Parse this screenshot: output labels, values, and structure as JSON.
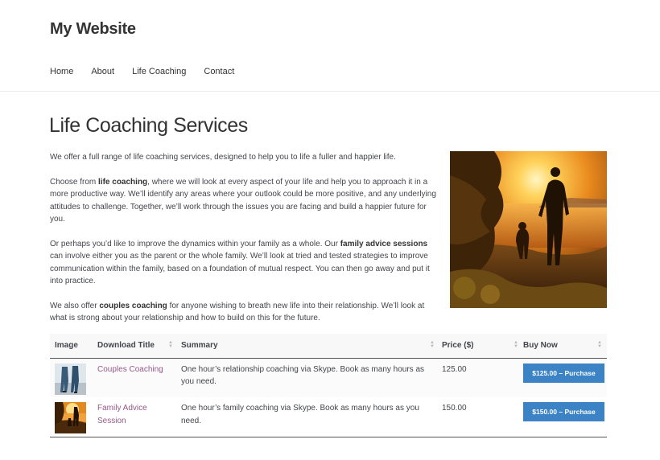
{
  "site": {
    "title": "My Website"
  },
  "nav": {
    "items": [
      "Home",
      "About",
      "Life Coaching",
      "Contact"
    ]
  },
  "page": {
    "title": "Life Coaching Services",
    "p1": "We offer a full range of life coaching services, designed to help you to life a fuller and happier life.",
    "p2_a": "Choose from ",
    "p2_b": "life coaching",
    "p2_c": ", where we will look at every aspect of your life and help you to approach it in a more productive way. We’ll identify any areas where your outlook could be more positive, and any underlying attitudes to challenge. Together, we’ll work through the issues you are facing and build a happier future for you.",
    "p3_a": "Or perhaps you’d like to improve the dynamics within your family as a whole. Our ",
    "p3_b": "family advice sessions",
    "p3_c": " can involve either you as the parent or the whole family. We’ll look at tried and tested strategies to improve communication within the family, based on a foundation of mutual respect. You can then go away and put it into practice.",
    "p4_a": "We also offer ",
    "p4_b": "couples coaching",
    "p4_c": " for anyone wishing to breath new life into their relationship. We’ll look at what is strong about your relationship and how to build on this for the future."
  },
  "table": {
    "headers": [
      "Image",
      "Download Title",
      "Summary",
      "Price ($)",
      "Buy Now"
    ],
    "rows": [
      {
        "title": "Couples Coaching",
        "summary": "One hour’s relationship coaching via Skype. Book as many hours as you need.",
        "price": "125.00",
        "button": "$125.00 – Purchase"
      },
      {
        "title": "Family Advice Session",
        "summary": "One hour’s family coaching via Skype. Book as many hours as you need.",
        "price": "150.00",
        "button": "$150.00 – Purchase"
      }
    ]
  },
  "colors": {
    "link": "#96588a",
    "button": "#3c83c6",
    "text": "#43454b"
  }
}
